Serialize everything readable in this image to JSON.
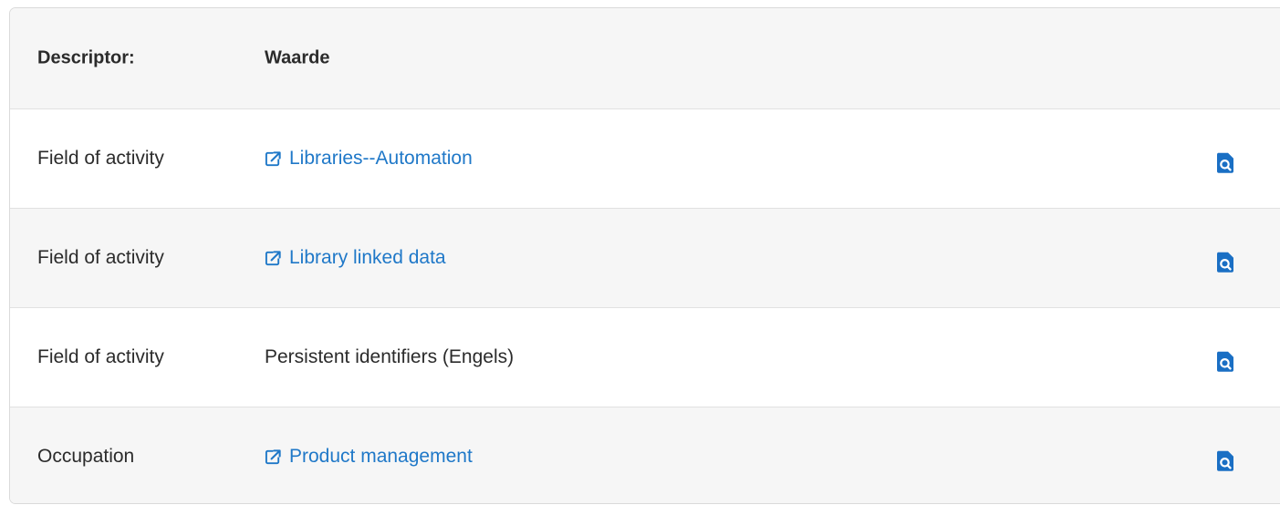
{
  "table": {
    "header": {
      "descriptor": "Descriptor:",
      "value": "Waarde"
    },
    "rows": [
      {
        "descriptor": "Field of activity",
        "value": "Libraries--Automation",
        "is_link": true
      },
      {
        "descriptor": "Field of activity",
        "value": "Library linked data",
        "is_link": true
      },
      {
        "descriptor": "Field of activity",
        "value": "Persistent identifiers (Engels)",
        "is_link": false
      },
      {
        "descriptor": "Occupation",
        "value": "Product management",
        "is_link": true
      }
    ]
  },
  "icons": {
    "external_link": "external-link-icon",
    "search_document": "document-search-icon"
  },
  "colors": {
    "link": "#1f78c8",
    "icon": "#1a6fc4",
    "header_bg": "#f6f6f6",
    "row_alt_bg": "#f6f6f6"
  }
}
